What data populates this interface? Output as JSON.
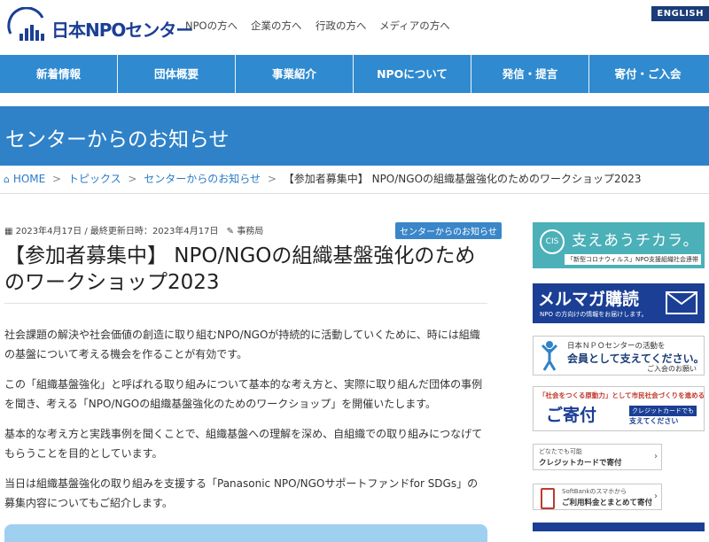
{
  "header": {
    "logo_text": "日本NPOセンター",
    "top_links": [
      "NPOの方へ",
      "企業の方へ",
      "行政の方へ",
      "メディアの方へ"
    ],
    "english_label": "ENGLISH"
  },
  "nav": {
    "items": [
      "新着情報",
      "団体概要",
      "事業紹介",
      "NPOについて",
      "発信・提言",
      "寄付・ご入会"
    ]
  },
  "banner": {
    "title": "センターからのお知らせ"
  },
  "breadcrumb": {
    "home": "HOME",
    "topics": "トピックス",
    "news": "センターからのお知らせ",
    "sep": ">",
    "current": "【参加者募集中】 NPO/NGOの組織基盤強化のためのワークショップ2023"
  },
  "post": {
    "date": "2023年4月17日",
    "updated_label": "/ 最終更新日時：",
    "updated": "2023年4月17日",
    "author": "事務局",
    "category": "センターからのお知らせ",
    "title": "【参加者募集中】 NPO/NGOの組織基盤強化のためのワークショップ2023",
    "paragraphs": [
      "社会課題の解決や社会価値の創造に取り組むNPO/NGOが持続的に活動していくために、時には組織の基盤について考える機会を作ることが有効です。",
      "この「組織基盤強化」と呼ばれる取り組みについて基本的な考え方と、実際に取り組んだ団体の事例を聞き、考える「NPO/NGOの組織基盤強化のためのワークショップ」を開催いたします。",
      "基本的な考え方と実践事例を聞くことで、組織基盤への理解を深め、自組織での取り組みにつなげてもらうことを目的としています。",
      "当日は組織基盤強化の取り組みを支援する「Panasonic NPO/NGOサポートファンドfor SDGs」の募集内容についてもご紹介します。"
    ]
  },
  "sidebar": {
    "cis": {
      "mark": "CIS",
      "title": "支えあうチカラ。",
      "sub": "「新型コロナウィルス」NPO支援組織社会連帯"
    },
    "mailmag": {
      "title": "メルマガ購読",
      "sub": "NPO の方向けの情報をお届けします。"
    },
    "member": {
      "line1": "日本ＮＰＯセンターの活動を",
      "line2": "会員として支えてください。",
      "line3": "ご入会のお願い"
    },
    "donate": {
      "line1": "「社会をつくる原動力」として市民社会づくりを進めるため",
      "line2": "ご寄付",
      "line3": "クレジットカードでも",
      "line4": "支えてください"
    },
    "credit": {
      "line1": "どなたでも可能",
      "line2": "クレジットカードで寄付"
    },
    "softbank": {
      "line1": "SoftBankのスマホから",
      "line2": "ご利用料金とまとめて寄付"
    }
  },
  "colors": {
    "nav_blue": "#2f8ad0",
    "banner_blue": "#2f82c8",
    "navy": "#1b3f95",
    "link": "#2a7cc7"
  }
}
